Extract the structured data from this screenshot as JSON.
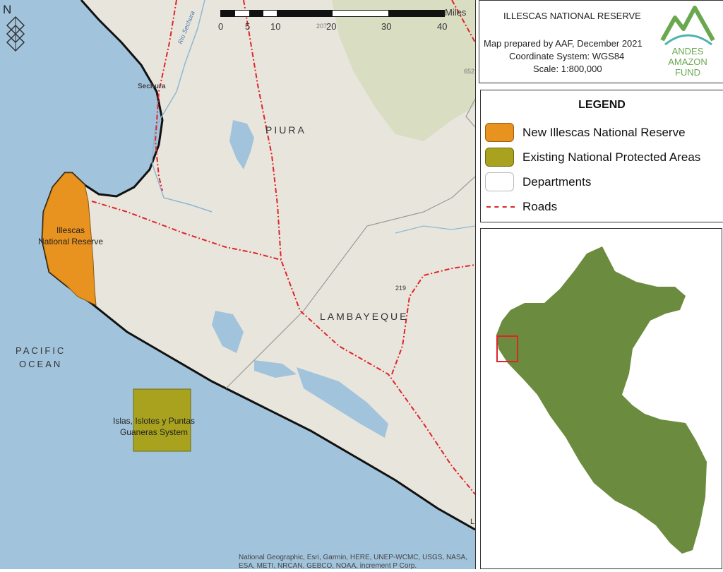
{
  "title_box": {
    "title": "ILLESCAS NATIONAL RESERVE",
    "prepared_by": "Map prepared by AAF, December 2021",
    "coord_system": "Coordinate System: WGS84",
    "scale": "Scale: 1:800,000",
    "logo_text": "ANDES AMAZON FUND"
  },
  "legend": {
    "title": "LEGEND",
    "items": [
      {
        "label": "New Illescas National Reserve",
        "color": "#e8921f"
      },
      {
        "label": "Existing National Protected Areas",
        "color": "#a8a21f"
      },
      {
        "label": "Departments",
        "color": "#ffffff"
      },
      {
        "label": "Roads",
        "color": "#e0232a"
      }
    ]
  },
  "map": {
    "north_label": "N",
    "scale_unit": "Miles",
    "scale_ticks": [
      "0",
      "5",
      "10",
      "20",
      "30",
      "40"
    ],
    "labels": {
      "sechura": "Sechura",
      "rio_sechura": "Rio Sechura",
      "piura": "PIURA",
      "lambayeque": "LAMBAYEQUE",
      "illescas": "Illescas\nNational Reserve",
      "pacific": "PACIFIC\nOCEAN",
      "islas": "Islas, Islotes y Puntas\nGuaneras System",
      "elev": "219",
      "elev2": "652",
      "elev3": "207",
      "edge_L": "L"
    },
    "attribution": "National Geographic, Esri, Garmin, HERE, UNEP-WCMC, USGS, NASA, ESA, METI, NRCAN, GEBCO, NOAA, increment P Corp."
  },
  "colors": {
    "ocean": "#a2c3dc",
    "land": "#e8e6dc",
    "peru": "#6b8c3e",
    "inset_marker": "#e0232a"
  }
}
